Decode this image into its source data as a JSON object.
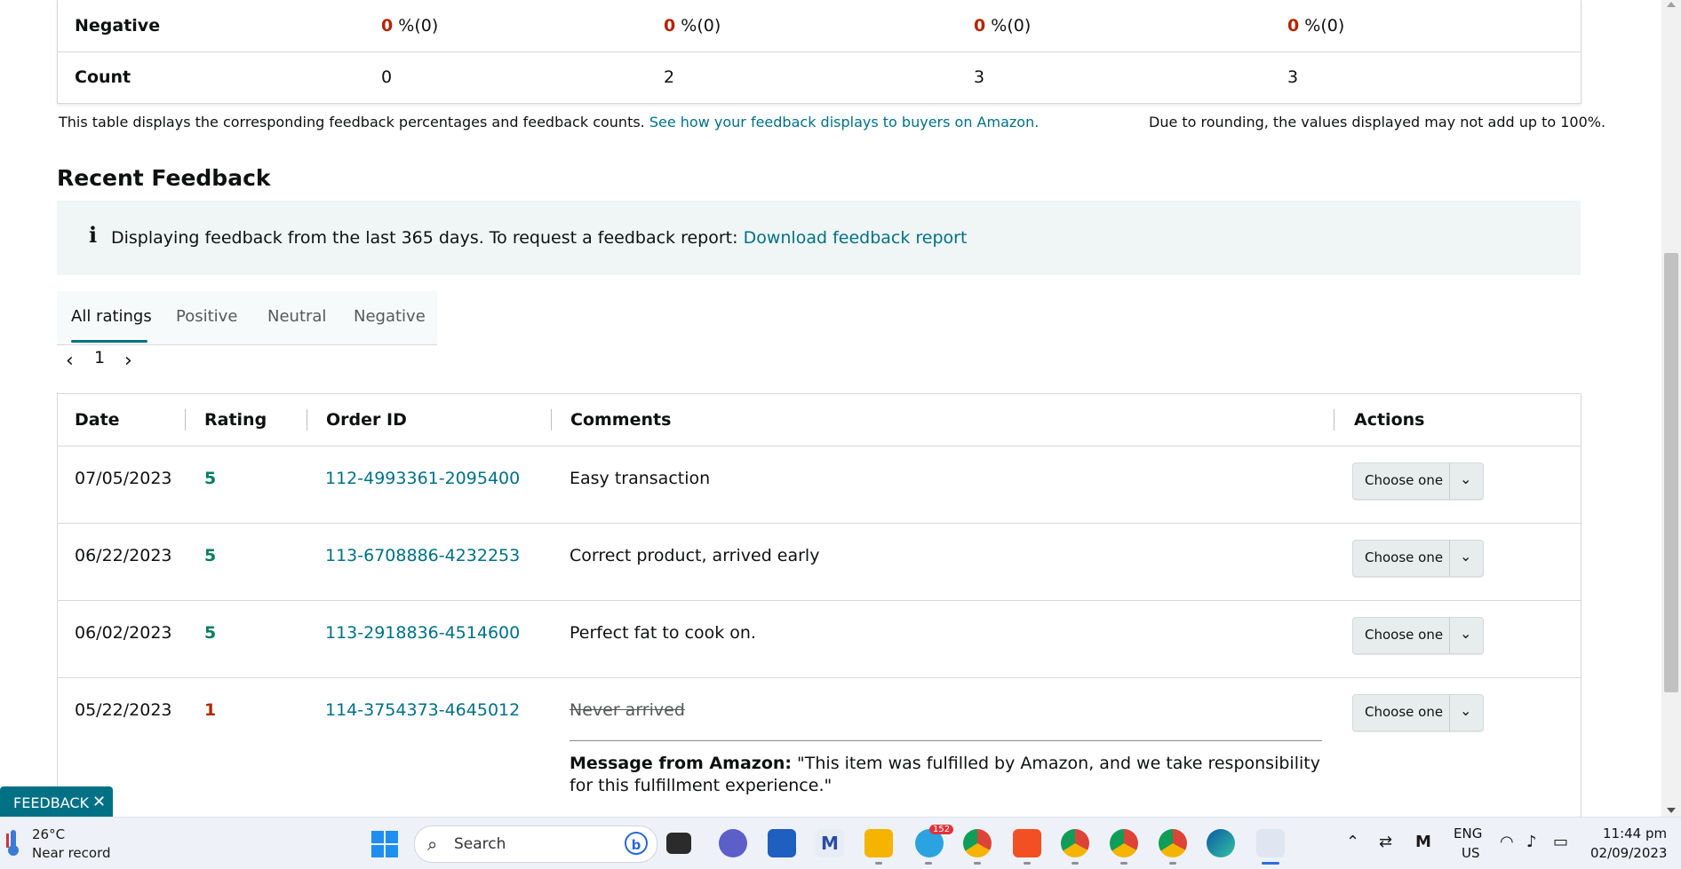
{
  "summary": {
    "negative_label": "Negative",
    "count_label": "Count",
    "negative": [
      {
        "bold": "0",
        "rest": " %(0)"
      },
      {
        "bold": "0",
        "rest": " %(0)"
      },
      {
        "bold": "0",
        "rest": " %(0)"
      },
      {
        "bold": "0",
        "rest": " %(0)"
      }
    ],
    "counts": [
      "0",
      "2",
      "3",
      "3"
    ],
    "note_text": "This table displays the corresponding feedback percentages and feedback counts.",
    "note_link": "See how your feedback displays to buyers on Amazon.",
    "rounding_note": "Due to rounding, the values displayed may not add up to 100%."
  },
  "recent": {
    "title": "Recent Feedback",
    "info_icon": "i",
    "info_text": "Displaying feedback from the last 365 days. To request a feedback report:",
    "info_link": "Download feedback report"
  },
  "tabs": [
    "All ratings",
    "Positive",
    "Neutral",
    "Negative"
  ],
  "pager": {
    "prev": "‹",
    "page": "1",
    "next": "›"
  },
  "table": {
    "headers": {
      "date": "Date",
      "rating": "Rating",
      "order_id": "Order ID",
      "comments": "Comments",
      "actions": "Actions"
    },
    "rows": [
      {
        "date": "07/05/2023",
        "rating": "5",
        "order_id": "112-4993361-2095400",
        "comment": "Easy transaction",
        "action": "Choose one"
      },
      {
        "date": "06/22/2023",
        "rating": "5",
        "order_id": "113-6708886-4232253",
        "comment": "Correct product, arrived early",
        "action": "Choose one"
      },
      {
        "date": "06/02/2023",
        "rating": "5",
        "order_id": "113-2918836-4514600",
        "comment": "Perfect fat to cook on.",
        "action": "Choose one"
      },
      {
        "date": "05/22/2023",
        "rating": "1",
        "order_id": "114-3754373-4645012",
        "comment": "Never arrived",
        "action": "Choose one",
        "message_label": "Message from Amazon:",
        "message_text": " \"This item was fulfilled by Amazon, and we take responsibility for this fulfillment experience.\""
      }
    ]
  },
  "feedback_button": {
    "label": "FEEDBACK",
    "close": "✕"
  },
  "taskbar": {
    "weather_temp": "26°C",
    "weather_sub": "Near record",
    "search_placeholder": "Search",
    "telegram_badge": "152",
    "lang_line1": "ENG",
    "lang_line2": "US",
    "time": "11:44 pm",
    "date": "02/09/2023"
  },
  "colors": {
    "link": "#007185",
    "negative": "#b12704",
    "positive": "#067d62",
    "info_bg": "#f0f5f5"
  }
}
